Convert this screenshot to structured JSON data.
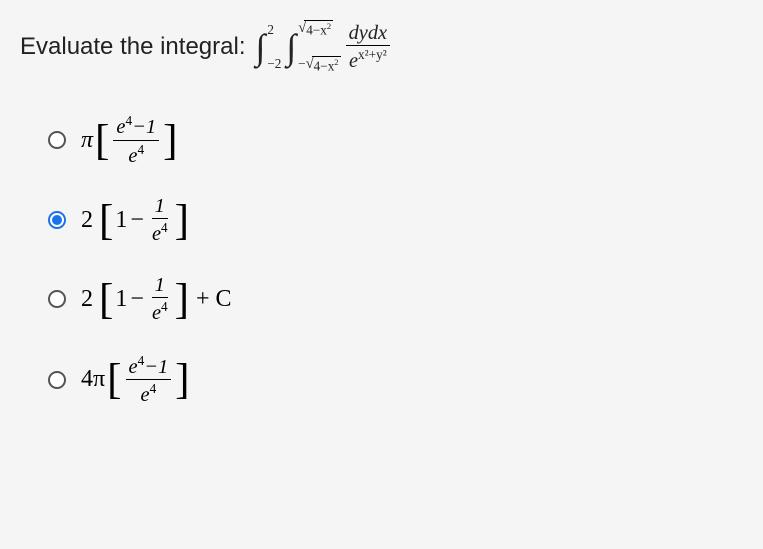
{
  "question": {
    "prompt": "Evaluate the integral:",
    "integral": {
      "outer_lower": "−2",
      "outer_upper": "2",
      "inner_lower_neg": "−",
      "inner_sqrt_content": "4−x",
      "inner_sqrt_exp": "2",
      "integrand_num": "dydx",
      "integrand_den_base": "e",
      "integrand_den_exp": "x²+y²"
    }
  },
  "options": {
    "a": {
      "coeff": "π",
      "frac_num_a": "e",
      "frac_num_exp": "4",
      "frac_num_b": "−1",
      "frac_den_a": "e",
      "frac_den_exp": "4"
    },
    "b": {
      "coeff": "2",
      "one": "1",
      "minus": "−",
      "frac_num": "1",
      "frac_den_a": "e",
      "frac_den_exp": "4"
    },
    "c": {
      "coeff": "2",
      "one": "1",
      "minus": "−",
      "frac_num": "1",
      "frac_den_a": "e",
      "frac_den_exp": "4",
      "plus_c": "+ C"
    },
    "d": {
      "coeff": "4π",
      "frac_num_a": "e",
      "frac_num_exp": "4",
      "frac_num_b": "−1",
      "frac_den_a": "e",
      "frac_den_exp": "4"
    }
  },
  "selected": "b"
}
